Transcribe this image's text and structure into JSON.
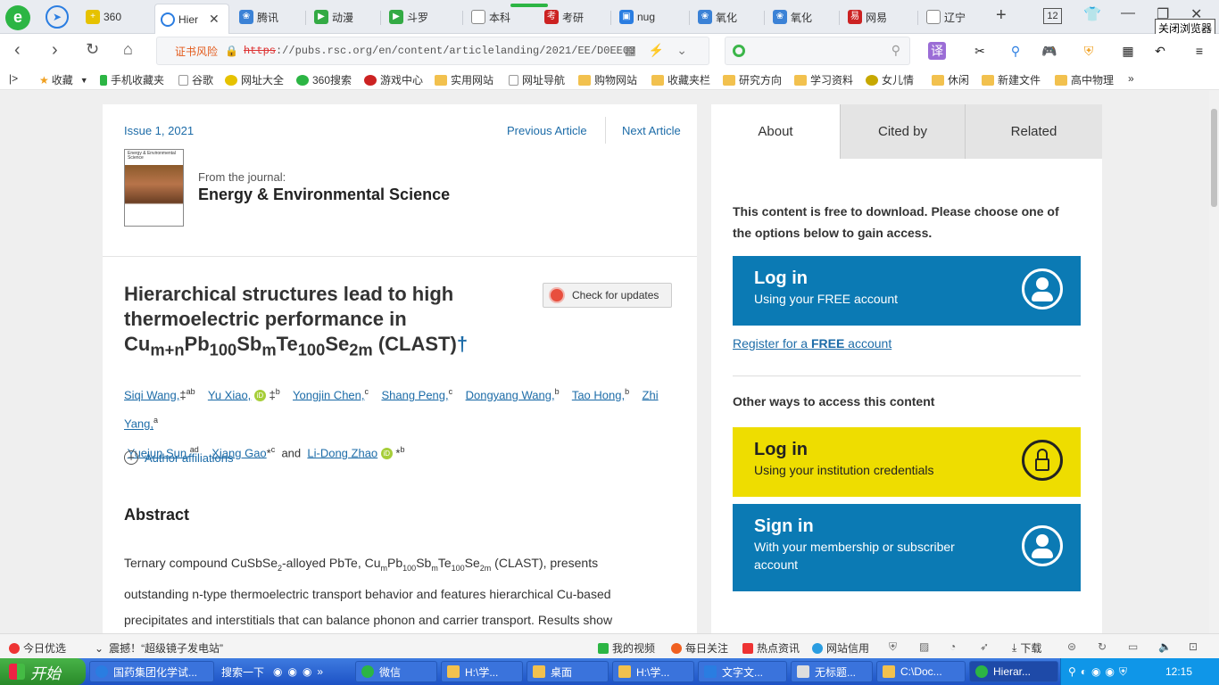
{
  "tabs": [
    {
      "label": "360",
      "color": "#e6c200"
    },
    {
      "label": "Hier",
      "color": "#2a7de1"
    },
    {
      "label": "腾讯",
      "color": "#3b82d6"
    },
    {
      "label": "动漫",
      "color": "#33aa44"
    },
    {
      "label": "斗罗",
      "color": "#33aa44"
    },
    {
      "label": "本科",
      "color": "#888888"
    },
    {
      "label": "考研",
      "color": "#cc2222"
    },
    {
      "label": "nug",
      "color": "#2a7de1"
    },
    {
      "label": "氧化",
      "color": "#3b82d6"
    },
    {
      "label": "氧化",
      "color": "#3b82d6"
    },
    {
      "label": "网易",
      "color": "#cc2222"
    },
    {
      "label": "辽宁",
      "color": "#888888"
    }
  ],
  "tab_count": "12",
  "close_tooltip": "关闭浏览器",
  "address": {
    "cert_warning": "证书风险",
    "scheme": "https",
    "url_rest": "://pubs.rsc.org/en/content/articlelanding/2021/EE/D0EE03"
  },
  "bookmarks": [
    "收藏",
    "手机收藏夹",
    "谷歌",
    "网址大全",
    "360搜索",
    "游戏中心",
    "实用网站",
    "网址导航",
    "购物网站",
    "收藏夹栏",
    "研究方向",
    "学习资料",
    "女儿情",
    "休闲",
    "新建文件",
    "高中物理"
  ],
  "bookmark_more": "»",
  "article": {
    "issue": "Issue 1, 2021",
    "prev": "Previous Article",
    "next": "Next Article",
    "cover_text": "Energy & Environmental Science",
    "from_journal": "From the journal:",
    "journal": "Energy & Environmental Science",
    "title_line1": "Hierarchical structures lead to high",
    "title_line2": "thermoelectric performance in",
    "title_f1": "Cu",
    "title_s1": "m+n",
    "title_f2": "Pb",
    "title_s2": "100",
    "title_f3": "Sb",
    "title_s3": "m",
    "title_f4": "Te",
    "title_s4": "100",
    "title_f5": "Se",
    "title_s5": "2m",
    "title_tail": " (CLAST)",
    "title_dagger": "†",
    "check_updates": "Check for updates",
    "authors": [
      {
        "name": "Siqi Wang,",
        "mark": "‡",
        "sup": "ab"
      },
      {
        "name": "Yu Xiao,",
        "orcid": true,
        "mark": "‡",
        "sup": "b"
      },
      {
        "name": "Yongjin Chen,",
        "sup": "c"
      },
      {
        "name": "Shang Peng,",
        "sup": "c"
      },
      {
        "name": "Dongyang Wang,",
        "sup": "b"
      },
      {
        "name": "Tao Hong,",
        "sup": "b"
      },
      {
        "name": "Zhi Yang,",
        "sup": "a"
      },
      {
        "name": "Yuejun Sun,",
        "sup": "ad"
      },
      {
        "name": "Xiang Gao",
        "mark": "*",
        "sup": "c"
      },
      {
        "name": "Li-Dong Zhao",
        "orcid": true,
        "mark": "*",
        "sup": "b"
      }
    ],
    "and_word": "and",
    "affiliations": "Author affiliations",
    "abstract_heading": "Abstract",
    "abstract_p1a": "Ternary compound CuSbSe",
    "abstract_p1a_sub": "2",
    "abstract_p1b": "-alloyed PbTe, Cu",
    "abstract_sub_m": "m",
    "abstract_pb": "Pb",
    "abstract_sub_100": "100",
    "abstract_sb": "Sb",
    "abstract_te": "Te",
    "abstract_se": "Se",
    "abstract_sub_2m": "2m",
    "abstract_p1c": " (CLAST), presents",
    "abstract_line2": "outstanding n-type thermoelectric transport behavior and features hierarchical Cu-based",
    "abstract_line3": "precipitates and interstitials that can balance phonon and carrier transport. Results show"
  },
  "sidebar": {
    "tabs": [
      "About",
      "Cited by",
      "Related"
    ],
    "access_text": "This content is free to download. Please choose one of the options below to gain access.",
    "login_title": "Log in",
    "login_sub": "Using your FREE account",
    "register_pre": "Register for a ",
    "register_bold": "FREE",
    "register_post": " account",
    "other_ways": "Other ways to access this content",
    "inst_title": "Log in",
    "inst_sub": "Using your institution credentials",
    "signin_title": "Sign in",
    "signin_sub": "With your membership or subscriber account"
  },
  "statusbar": {
    "today": "今日优选",
    "news": "震撼！“超级镜子发电站”",
    "video": "我的视频",
    "daily": "每日关注",
    "hot": "热点资讯",
    "trust": "网站信用",
    "download": "下载"
  },
  "taskbar": {
    "start": "开始",
    "items": [
      "国药集团化学试...",
      "搜索一下",
      "微信",
      "H:\\学...",
      "桌面",
      "H:\\学...",
      "文字文...",
      "无标题...",
      "C:\\Doc...",
      "Hierar..."
    ],
    "clock": "12:15"
  }
}
